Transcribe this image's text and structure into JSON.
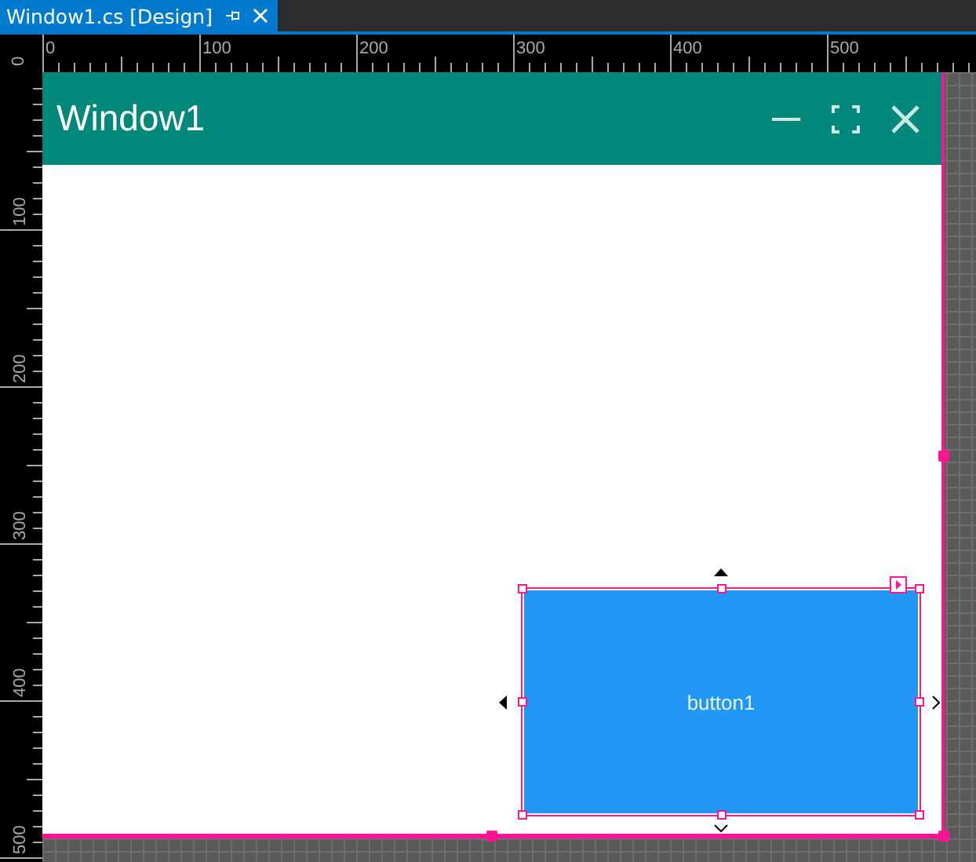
{
  "document_tab": {
    "title": "Window1.cs [Design]",
    "selected": true
  },
  "rulers": {
    "horizontal_labels": [
      "0",
      "100",
      "200",
      "300",
      "400",
      "500"
    ],
    "vertical_labels": [
      "0",
      "100",
      "200",
      "300",
      "400",
      "500"
    ]
  },
  "form": {
    "title": "Window1"
  },
  "controls": [
    {
      "kind": "button",
      "text": "button1",
      "selected": true
    }
  ]
}
